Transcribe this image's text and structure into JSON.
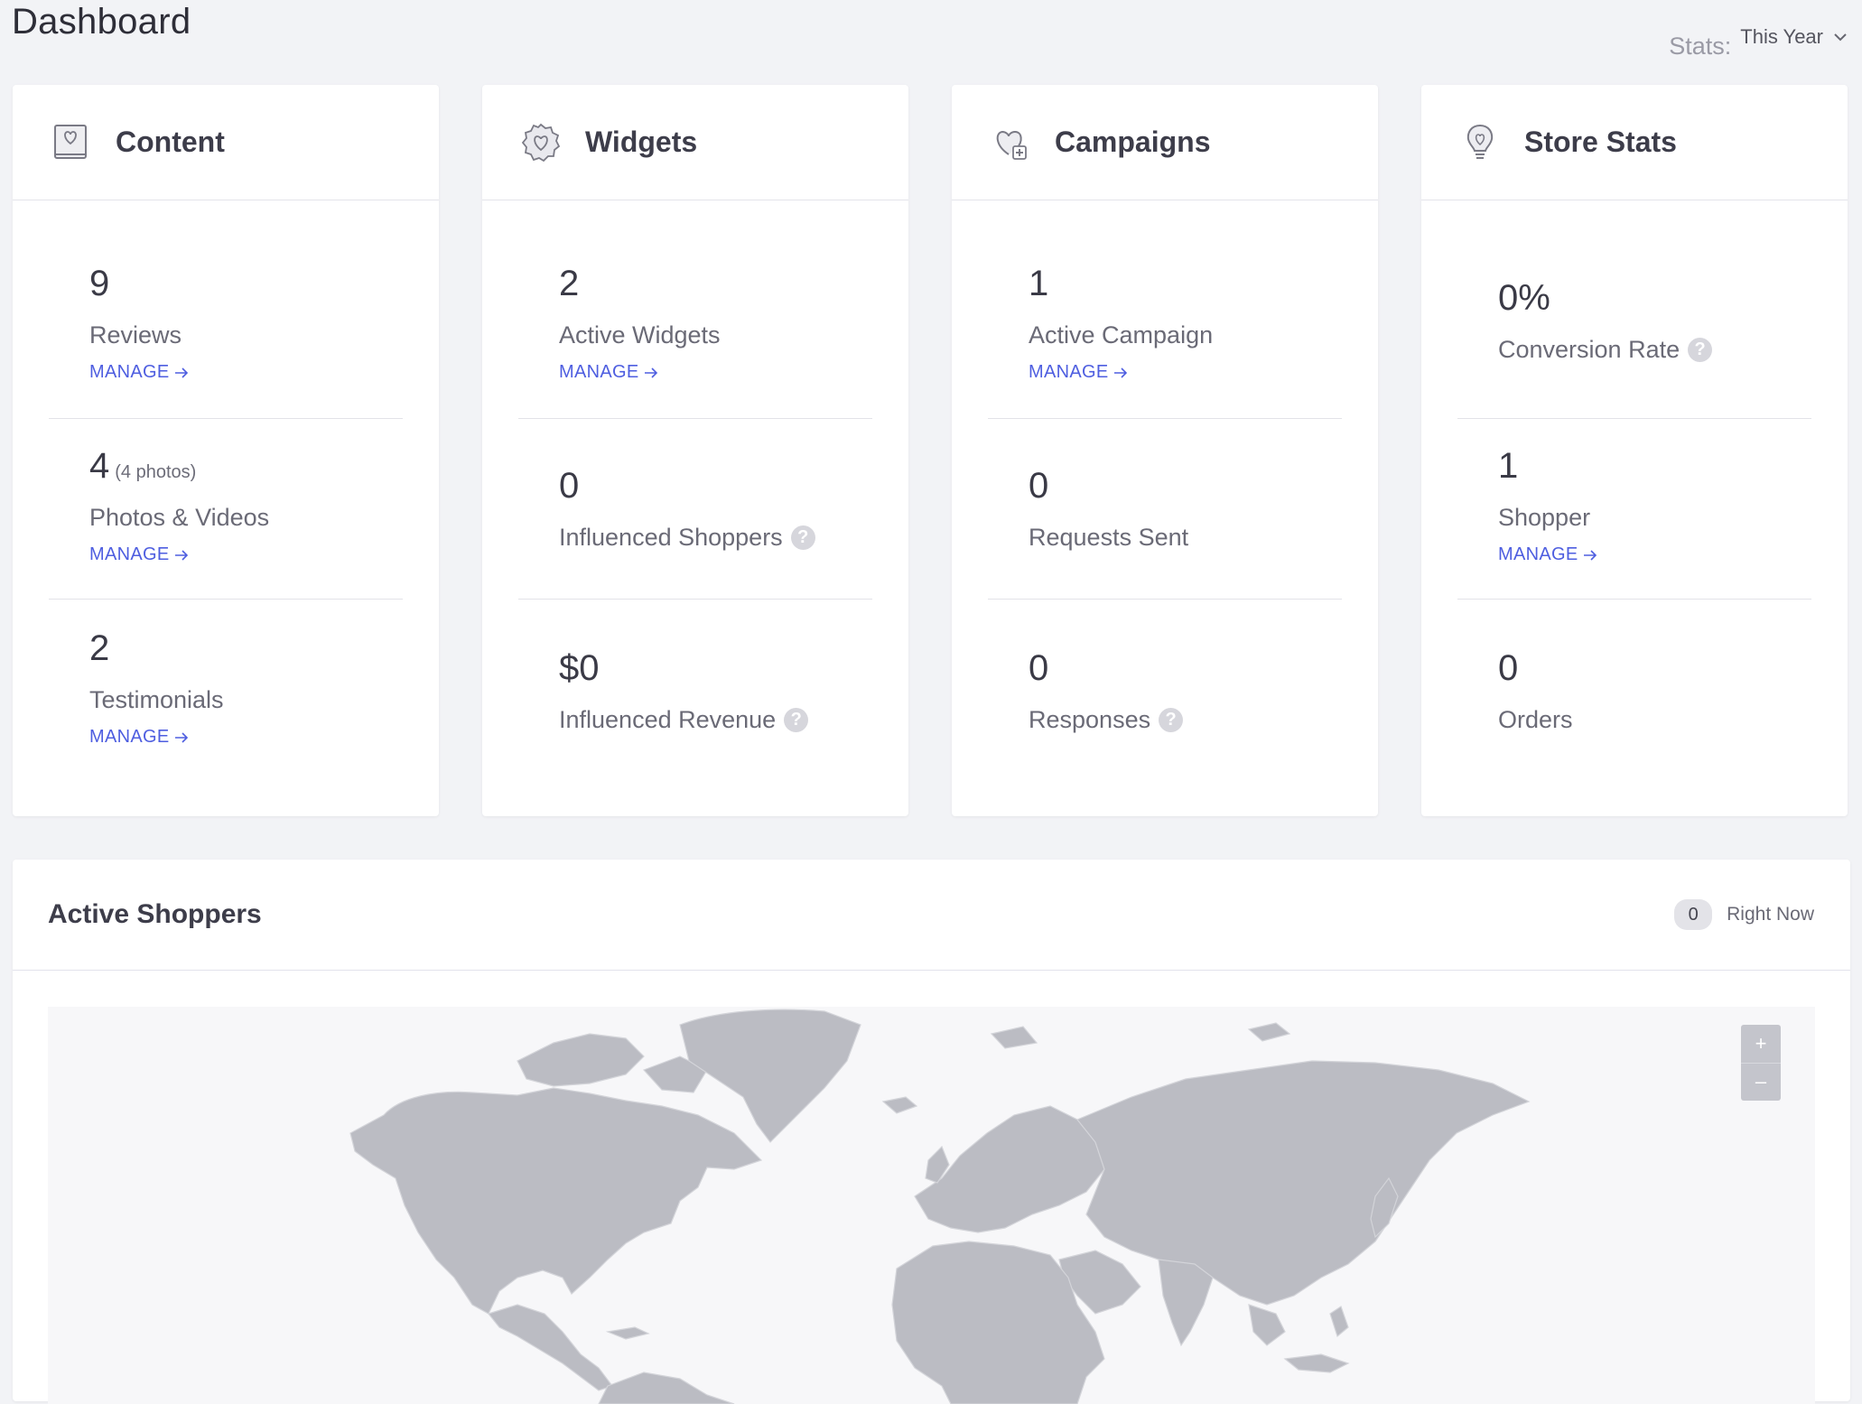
{
  "header": {
    "title": "Dashboard",
    "stats_label": "Stats:",
    "stats_value": "This Year"
  },
  "cards": [
    {
      "title": "Content",
      "icon": "book-heart-icon",
      "stats": [
        {
          "value": "9",
          "label": "Reviews",
          "manage": "MANAGE"
        },
        {
          "value": "4",
          "sub": "(4 photos)",
          "label": "Photos & Videos",
          "manage": "MANAGE"
        },
        {
          "value": "2",
          "label": "Testimonials",
          "manage": "MANAGE"
        }
      ]
    },
    {
      "title": "Widgets",
      "icon": "badge-heart-icon",
      "stats": [
        {
          "value": "2",
          "label": "Active Widgets",
          "manage": "MANAGE"
        },
        {
          "value": "0",
          "label": "Influenced Shoppers",
          "help": "?"
        },
        {
          "value": "$0",
          "label": "Influenced Revenue",
          "help": "?"
        }
      ]
    },
    {
      "title": "Campaigns",
      "icon": "heart-plus-icon",
      "stats": [
        {
          "value": "1",
          "label": "Active Campaign",
          "manage": "MANAGE"
        },
        {
          "value": "0",
          "label": "Requests Sent"
        },
        {
          "value": "0",
          "label": "Responses",
          "help": "?"
        }
      ]
    },
    {
      "title": "Store Stats",
      "icon": "lightbulb-heart-icon",
      "stats": [
        {
          "value": "0%",
          "label": "Conversion Rate",
          "help": "?"
        },
        {
          "value": "1",
          "label": "Shopper",
          "manage": "MANAGE"
        },
        {
          "value": "0",
          "label": "Orders"
        }
      ]
    }
  ],
  "active_shoppers": {
    "title": "Active Shoppers",
    "count": "0",
    "count_label": "Right Now",
    "zoom_in": "+",
    "zoom_out": "–"
  },
  "colors": {
    "accent": "#4e5ee0",
    "background": "#f2f3f6",
    "map_land": "#bbbcc3"
  }
}
